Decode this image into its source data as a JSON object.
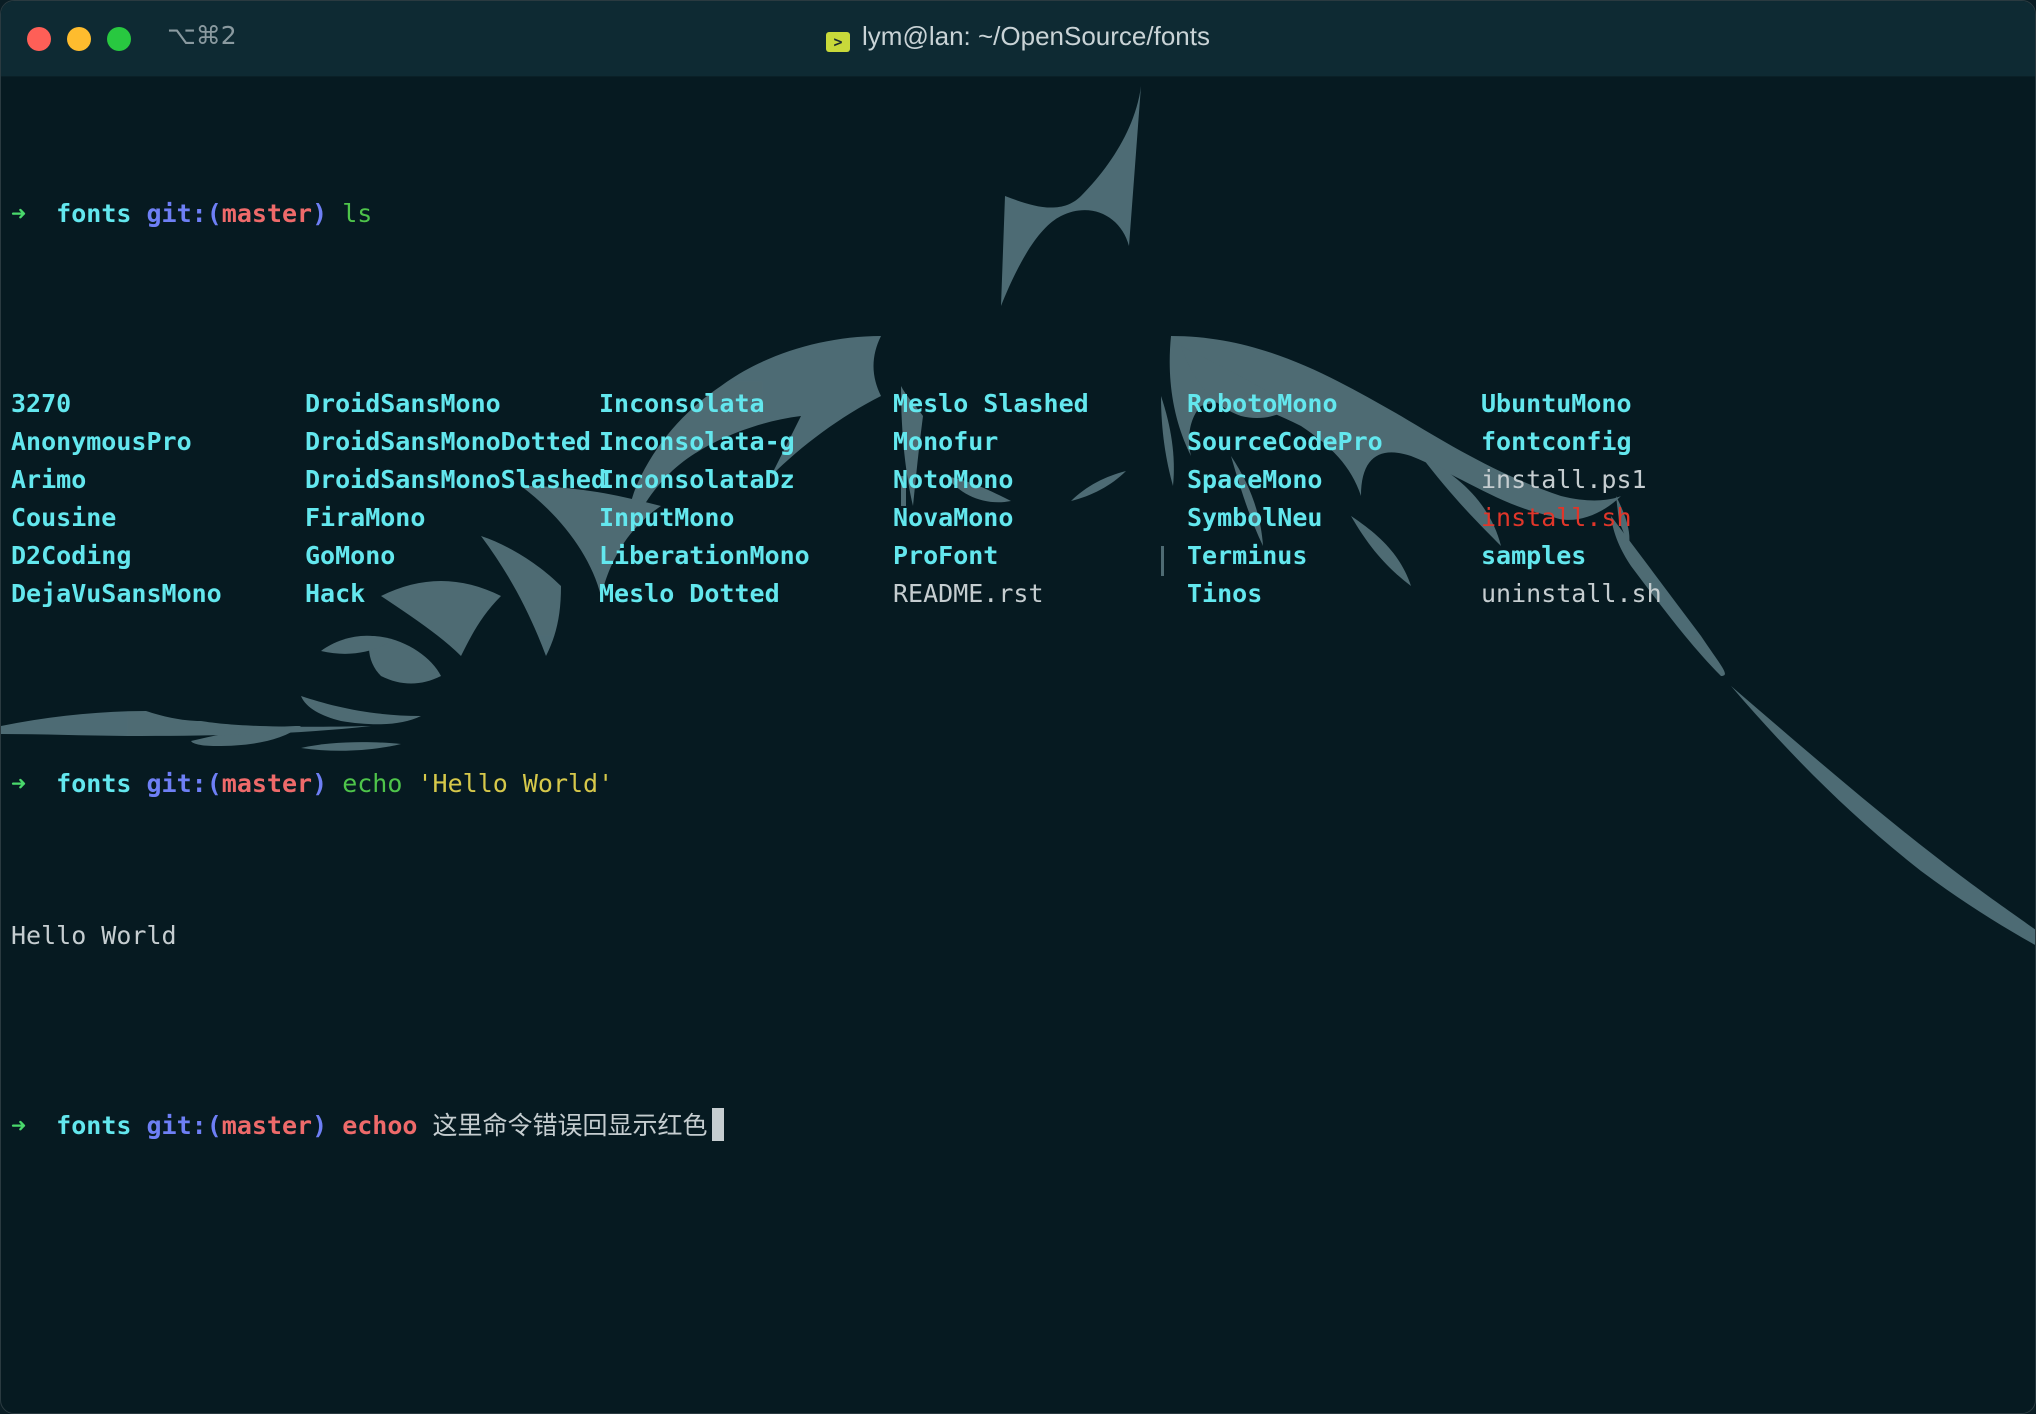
{
  "window": {
    "title": "lym@lan: ~/OpenSource/fonts",
    "shortcut": "⌥⌘2",
    "title_icon": "terminal-icon"
  },
  "prompt": {
    "arrow": "➜",
    "dir": "fonts",
    "git_prefix": "git:(",
    "branch": "master",
    "git_suffix": ")"
  },
  "commands": [
    {
      "cmd": "ls",
      "args": "",
      "status": "ok"
    },
    {
      "cmd": "echo",
      "args": "'Hello World'",
      "status": "ok"
    },
    {
      "cmd": "echoo",
      "args": "这里命令错误回显示红色",
      "status": "error"
    }
  ],
  "ls_output": {
    "columns": [
      [
        {
          "name": "3270",
          "kind": "dir"
        },
        {
          "name": "AnonymousPro",
          "kind": "dir"
        },
        {
          "name": "Arimo",
          "kind": "dir"
        },
        {
          "name": "Cousine",
          "kind": "dir"
        },
        {
          "name": "D2Coding",
          "kind": "dir"
        },
        {
          "name": "DejaVuSansMono",
          "kind": "dir"
        }
      ],
      [
        {
          "name": "DroidSansMono",
          "kind": "dir"
        },
        {
          "name": "DroidSansMonoDotted",
          "kind": "dir"
        },
        {
          "name": "DroidSansMonoSlashed",
          "kind": "dir"
        },
        {
          "name": "FiraMono",
          "kind": "dir"
        },
        {
          "name": "GoMono",
          "kind": "dir"
        },
        {
          "name": "Hack",
          "kind": "dir"
        }
      ],
      [
        {
          "name": "Inconsolata",
          "kind": "dir"
        },
        {
          "name": "Inconsolata-g",
          "kind": "dir"
        },
        {
          "name": "InconsolataDz",
          "kind": "dir"
        },
        {
          "name": "InputMono",
          "kind": "dir"
        },
        {
          "name": "LiberationMono",
          "kind": "dir"
        },
        {
          "name": "Meslo Dotted",
          "kind": "dir"
        }
      ],
      [
        {
          "name": "Meslo Slashed",
          "kind": "dir"
        },
        {
          "name": "Monofur",
          "kind": "dir"
        },
        {
          "name": "NotoMono",
          "kind": "dir"
        },
        {
          "name": "NovaMono",
          "kind": "dir"
        },
        {
          "name": "ProFont",
          "kind": "dir"
        },
        {
          "name": "README.rst",
          "kind": "file"
        }
      ],
      [
        {
          "name": "RobotoMono",
          "kind": "dir"
        },
        {
          "name": "SourceCodePro",
          "kind": "dir"
        },
        {
          "name": "SpaceMono",
          "kind": "dir"
        },
        {
          "name": "SymbolNeu",
          "kind": "dir"
        },
        {
          "name": "Terminus",
          "kind": "dir"
        },
        {
          "name": "Tinos",
          "kind": "dir"
        }
      ],
      [
        {
          "name": "UbuntuMono",
          "kind": "dir"
        },
        {
          "name": "fontconfig",
          "kind": "dir"
        },
        {
          "name": "install.ps1",
          "kind": "file"
        },
        {
          "name": "install.sh",
          "kind": "exec"
        },
        {
          "name": "samples",
          "kind": "dir"
        },
        {
          "name": "uninstall.sh",
          "kind": "file"
        }
      ]
    ]
  },
  "echo_output": "Hello World",
  "colors": {
    "background": "#061a21",
    "titlebar": "#0e2a33",
    "prompt_arrow": "#49d86b",
    "prompt_dir": "#63e7ee",
    "git": "#6e7ff5",
    "branch": "#ee6a6a",
    "command_ok": "#4ec44a",
    "command_error": "#ee6a6a",
    "string": "#d6c84a",
    "exec_file": "#e0362a",
    "wallpaper_art": "#5b7a82"
  }
}
